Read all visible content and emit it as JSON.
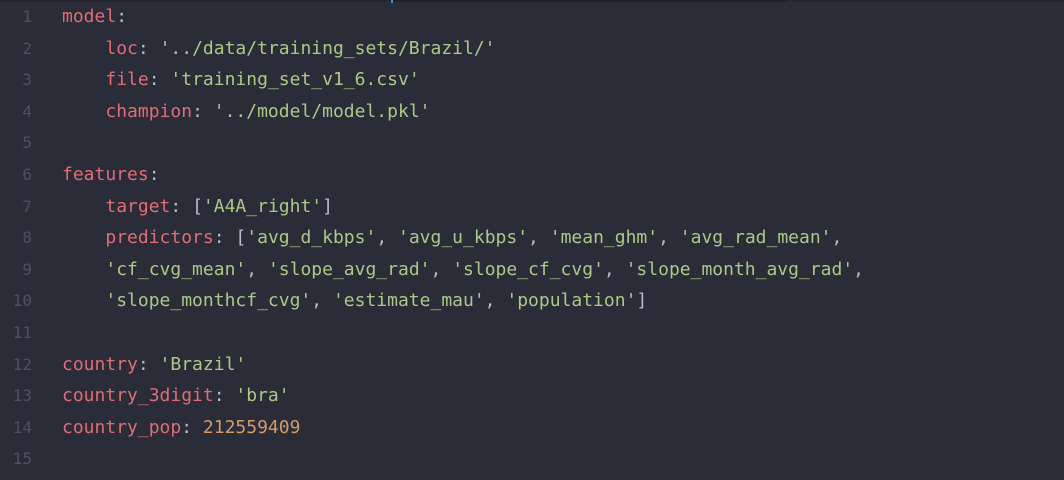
{
  "editor": {
    "colors": {
      "background": "#2a2d37",
      "gutter_text": "#4b5162",
      "key": "#e06c75",
      "string": "#a8c98a",
      "number": "#d19a66",
      "punctuation": "#b6bccb"
    },
    "lines": [
      {
        "num": "1",
        "key": "model",
        "colon": ":",
        "rest": []
      },
      {
        "num": "2",
        "indent": "    ",
        "key": "loc",
        "colon": ": ",
        "rest": [
          {
            "t": "str",
            "v": "'../data/training_sets/Brazil/'"
          }
        ]
      },
      {
        "num": "3",
        "indent": "    ",
        "key": "file",
        "colon": ": ",
        "rest": [
          {
            "t": "str",
            "v": "'training_set_v1_6.csv'"
          }
        ]
      },
      {
        "num": "4",
        "indent": "    ",
        "key": "champion",
        "colon": ": ",
        "rest": [
          {
            "t": "str",
            "v": "'../model/model.pkl'"
          }
        ]
      },
      {
        "num": "5",
        "key": "",
        "colon": "",
        "rest": []
      },
      {
        "num": "6",
        "key": "features",
        "colon": ":",
        "rest": []
      },
      {
        "num": "7",
        "indent": "    ",
        "key": "target",
        "colon": ": ",
        "rest": [
          {
            "t": "punc",
            "v": "["
          },
          {
            "t": "str",
            "v": "'A4A_right'"
          },
          {
            "t": "punc",
            "v": "]"
          }
        ]
      },
      {
        "num": "8",
        "indent": "    ",
        "key": "predictors",
        "colon": ": ",
        "rest": [
          {
            "t": "punc",
            "v": "["
          },
          {
            "t": "str",
            "v": "'avg_d_kbps'"
          },
          {
            "t": "punc",
            "v": ", "
          },
          {
            "t": "str",
            "v": "'avg_u_kbps'"
          },
          {
            "t": "punc",
            "v": ", "
          },
          {
            "t": "str",
            "v": "'mean_ghm'"
          },
          {
            "t": "punc",
            "v": ", "
          },
          {
            "t": "str",
            "v": "'avg_rad_mean'"
          },
          {
            "t": "punc",
            "v": ","
          }
        ]
      },
      {
        "num": "9",
        "indent": "    ",
        "key": "",
        "colon": "",
        "rest": [
          {
            "t": "str",
            "v": "'cf_cvg_mean'"
          },
          {
            "t": "punc",
            "v": ", "
          },
          {
            "t": "str",
            "v": "'slope_avg_rad'"
          },
          {
            "t": "punc",
            "v": ", "
          },
          {
            "t": "str",
            "v": "'slope_cf_cvg'"
          },
          {
            "t": "punc",
            "v": ", "
          },
          {
            "t": "str",
            "v": "'slope_month_avg_rad'"
          },
          {
            "t": "punc",
            "v": ","
          }
        ]
      },
      {
        "num": "10",
        "indent": "    ",
        "key": "",
        "colon": "",
        "rest": [
          {
            "t": "str",
            "v": "'slope_monthcf_cvg'"
          },
          {
            "t": "punc",
            "v": ", "
          },
          {
            "t": "str",
            "v": "'estimate_mau'"
          },
          {
            "t": "punc",
            "v": ", "
          },
          {
            "t": "str",
            "v": "'population'"
          },
          {
            "t": "punc",
            "v": "]"
          }
        ]
      },
      {
        "num": "11",
        "key": "",
        "colon": "",
        "rest": []
      },
      {
        "num": "12",
        "key": "country",
        "colon": ": ",
        "rest": [
          {
            "t": "str",
            "v": "'Brazil'"
          }
        ]
      },
      {
        "num": "13",
        "key": "country_3digit",
        "colon": ": ",
        "rest": [
          {
            "t": "str",
            "v": "'bra'"
          }
        ]
      },
      {
        "num": "14",
        "key": "country_pop",
        "colon": ": ",
        "rest": [
          {
            "t": "num",
            "v": "212559409"
          }
        ]
      },
      {
        "num": "15",
        "key": "",
        "colon": "",
        "rest": []
      }
    ]
  }
}
